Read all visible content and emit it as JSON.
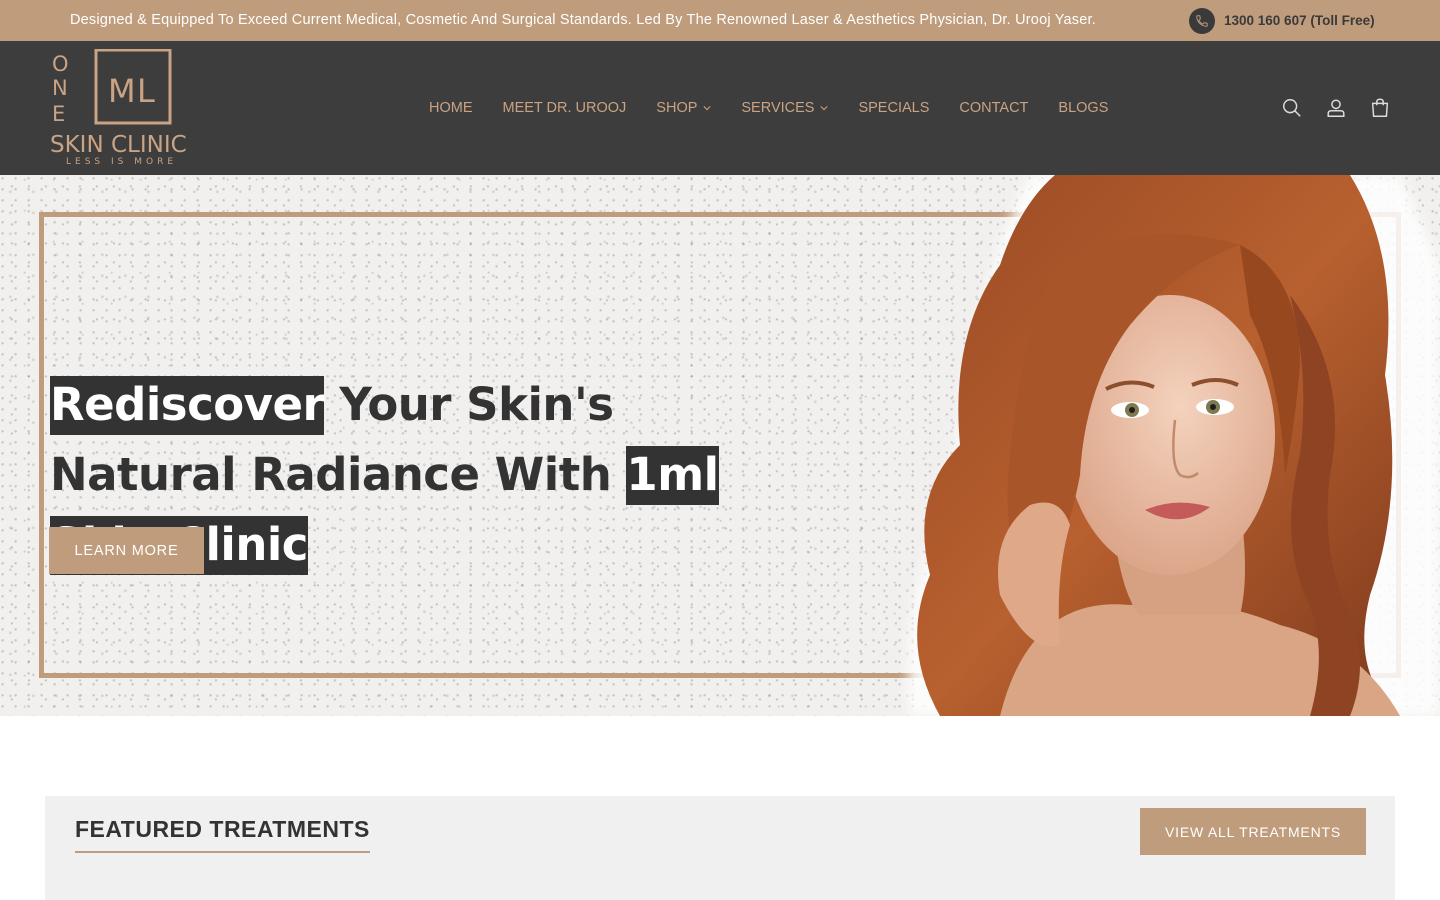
{
  "announcement": {
    "text": "Designed & Equipped To Exceed Current Medical, Cosmetic And Surgical Standards. Led By The Renowned Laser & Aesthetics Physician, Dr. Urooj Yaser.",
    "phone": "1300 160 607 (Toll Free)",
    "phone_icon": "phone-icon"
  },
  "header": {
    "logo": {
      "letters": [
        "O",
        "N",
        "E",
        "M",
        "L"
      ],
      "name": "SKIN CLINIC",
      "tagline": "LESS IS MORE"
    },
    "nav": [
      {
        "label": "HOME"
      },
      {
        "label": "MEET DR. UROOJ"
      },
      {
        "label": "SHOP",
        "dropdown": true
      },
      {
        "label": "SERVICES",
        "dropdown": true
      },
      {
        "label": "SPECIALS"
      },
      {
        "label": "CONTACT"
      },
      {
        "label": "BLOGS"
      }
    ],
    "icons": [
      "search-icon",
      "account-icon",
      "cart-icon"
    ]
  },
  "hero": {
    "heading_part1": "Rediscover",
    "heading_part2": " Your Skin's Natural Radiance With ",
    "heading_part3": "1ml Skin Clinic",
    "button": "LEARN MORE"
  },
  "featured": {
    "title": "FEATURED TREATMENTS",
    "button": "VIEW ALL TREATMENTS"
  },
  "colors": {
    "accent": "#bf9c7c",
    "header_bg": "#3d3d3d",
    "text_dark": "#333333",
    "nav_text": "#c9a383"
  }
}
